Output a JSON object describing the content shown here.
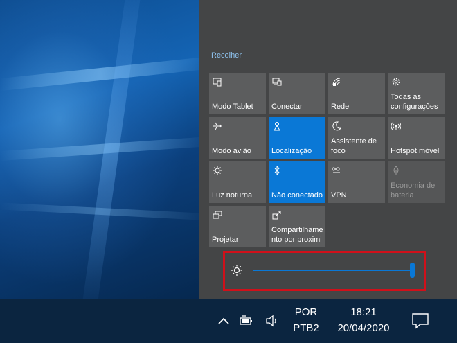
{
  "action_center": {
    "collapse_label": "Recolher",
    "tiles": [
      {
        "label": "Modo Tablet",
        "icon": "tablet-mode-icon",
        "state": "off"
      },
      {
        "label": "Conectar",
        "icon": "connect-icon",
        "state": "off"
      },
      {
        "label": "Rede",
        "icon": "network-icon",
        "state": "off"
      },
      {
        "label": "Todas as\nconfigurações",
        "icon": "gear-icon",
        "state": "off"
      },
      {
        "label": "Modo avião",
        "icon": "airplane-icon",
        "state": "off"
      },
      {
        "label": "Localização",
        "icon": "location-icon",
        "state": "on"
      },
      {
        "label": "Assistente de\nfoco",
        "icon": "moon-icon",
        "state": "off"
      },
      {
        "label": "Hotspot móvel",
        "icon": "hotspot-icon",
        "state": "off"
      },
      {
        "label": "Luz noturna",
        "icon": "night-light-icon",
        "state": "off"
      },
      {
        "label": "Não conectado",
        "icon": "bluetooth-icon",
        "state": "on"
      },
      {
        "label": "VPN",
        "icon": "vpn-icon",
        "state": "off"
      },
      {
        "label": "Economia de\nbateria",
        "icon": "battery-saver-icon",
        "state": "disabled"
      },
      {
        "label": "Projetar",
        "icon": "project-icon",
        "state": "off"
      },
      {
        "label": "Compartilhame\nnto por proximi",
        "icon": "nearby-share-icon",
        "state": "off"
      }
    ],
    "brightness": {
      "icon": "brightness-icon",
      "value_fraction": 1.0
    }
  },
  "colors": {
    "accent": "#0a78d6",
    "tile": "#5c5d5e",
    "panel": "#444546",
    "highlight_border": "#d0101a",
    "taskbar": "#0b2540"
  },
  "taskbar": {
    "language": "POR",
    "keyboard_layout": "PTB2",
    "time": "18:21",
    "date": "20/04/2020",
    "icons": [
      "chevron-up-icon",
      "battery-charging-icon",
      "volume-icon",
      "notification-icon"
    ]
  }
}
